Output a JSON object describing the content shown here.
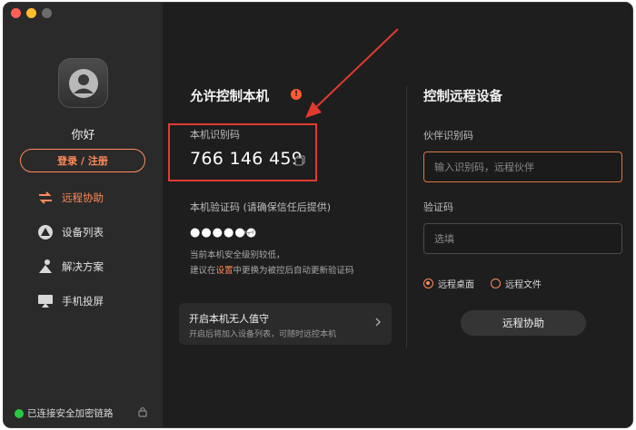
{
  "colors": {
    "accent": "#ff8a5b",
    "highlight_red": "#e23a2f",
    "status_green": "#28c840"
  },
  "sidebar": {
    "username": "你好",
    "login_label": "登录 / 注册",
    "items": [
      {
        "label": "远程协助",
        "icon": "remote-assist-icon",
        "active": true
      },
      {
        "label": "设备列表",
        "icon": "device-list-icon",
        "active": false
      },
      {
        "label": "解决方案",
        "icon": "solution-icon",
        "active": false
      },
      {
        "label": "手机投屏",
        "icon": "screen-cast-icon",
        "active": false
      }
    ],
    "status": "已连接安全加密链路"
  },
  "allow": {
    "title": "允许控制本机",
    "device_id_label": "本机识别码",
    "device_id": "766 146 459",
    "verify_label": "本机验证码 (请确保信任后提供)",
    "verify_masked": "●●●●●●",
    "note_line1": "当前本机安全级别较低，",
    "note_line2_pre": "建议在",
    "note_line2_link": "设置",
    "note_line2_post": "中更换为被控后自动更新验证码",
    "unattended_title": "开启本机无人值守",
    "unattended_desc": "开启后将加入设备列表，可随时远控本机"
  },
  "control": {
    "title": "控制远程设备",
    "partner_label": "伙伴识别码",
    "partner_placeholder": "输入识别码，远程伙伴",
    "code_label": "验证码",
    "code_placeholder": "选填",
    "radio_desktop": "远程桌面",
    "radio_file": "远程文件",
    "selected_mode": "远程桌面",
    "button": "远程协助"
  }
}
